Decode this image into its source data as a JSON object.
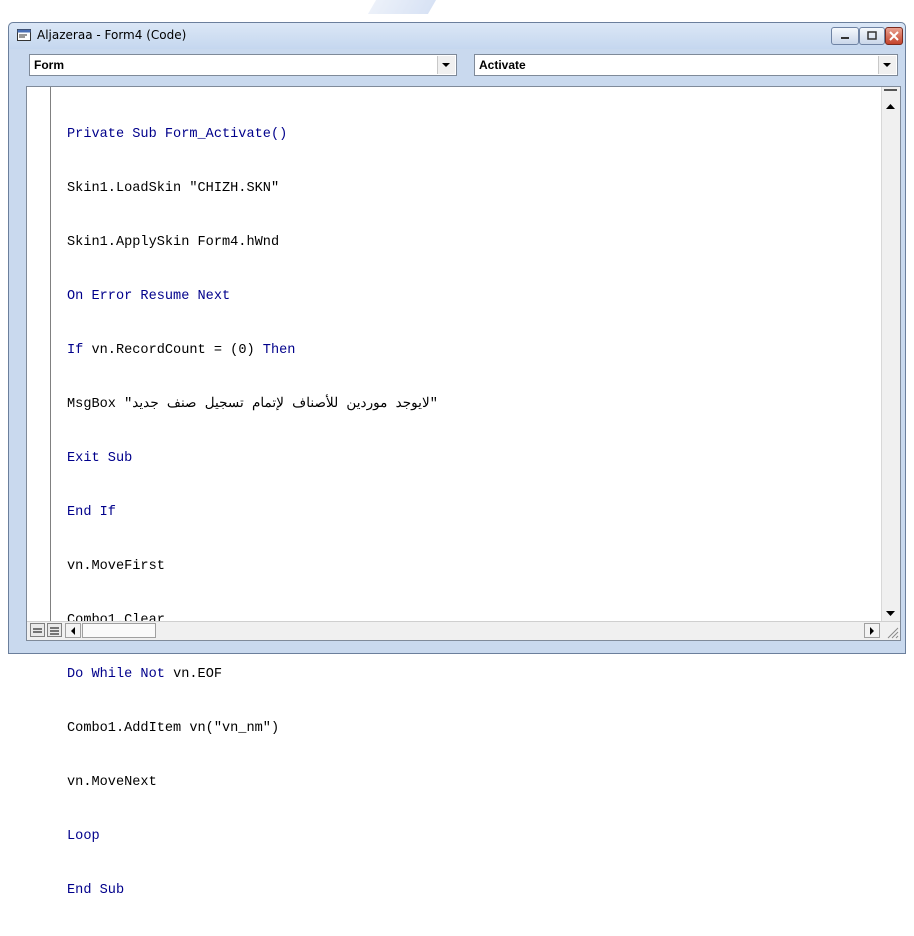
{
  "window": {
    "title": "Aljazeraa - Form4 (Code)"
  },
  "object_combo": {
    "value": "Form"
  },
  "procedure_combo": {
    "value": "Activate"
  },
  "code": {
    "lines": [
      {
        "text": "Private Sub Form_Activate()",
        "type": "keyword"
      },
      {
        "text": "Skin1.LoadSkin \"CHIZH.SKN\"",
        "type": "normal"
      },
      {
        "text": "Skin1.ApplySkin Form4.hWnd",
        "type": "normal"
      },
      {
        "text": "On Error Resume Next",
        "type": "keyword"
      },
      {
        "text": "If vn.RecordCount = (0) Then",
        "type": "mixed"
      },
      {
        "text": "MsgBox \"لايوجد موردين للأصناف لإتمام تسجيل صنف جديد\"",
        "type": "normal"
      },
      {
        "text": "Exit Sub",
        "type": "keyword"
      },
      {
        "text": "End If",
        "type": "keyword"
      },
      {
        "text": "vn.MoveFirst",
        "type": "normal"
      },
      {
        "text": "Combo1.Clear",
        "type": "normal"
      },
      {
        "text": "Do While Not vn.EOF",
        "type": "mixed2"
      },
      {
        "text": "Combo1.AddItem vn(\"vn_nm\")",
        "type": "normal"
      },
      {
        "text": "vn.MoveNext",
        "type": "normal"
      },
      {
        "text": "Loop",
        "type": "keyword"
      },
      {
        "text": "End Sub",
        "type": "keyword"
      }
    ]
  },
  "colors": {
    "keyword": "#00008b",
    "text": "#000000",
    "title_bar": "#c9d9ee",
    "close_button": "#c4432c"
  },
  "icons": {
    "app": "vb-code-window-icon",
    "minimize": "minimize-icon",
    "maximize": "maximize-icon",
    "close": "close-icon"
  }
}
